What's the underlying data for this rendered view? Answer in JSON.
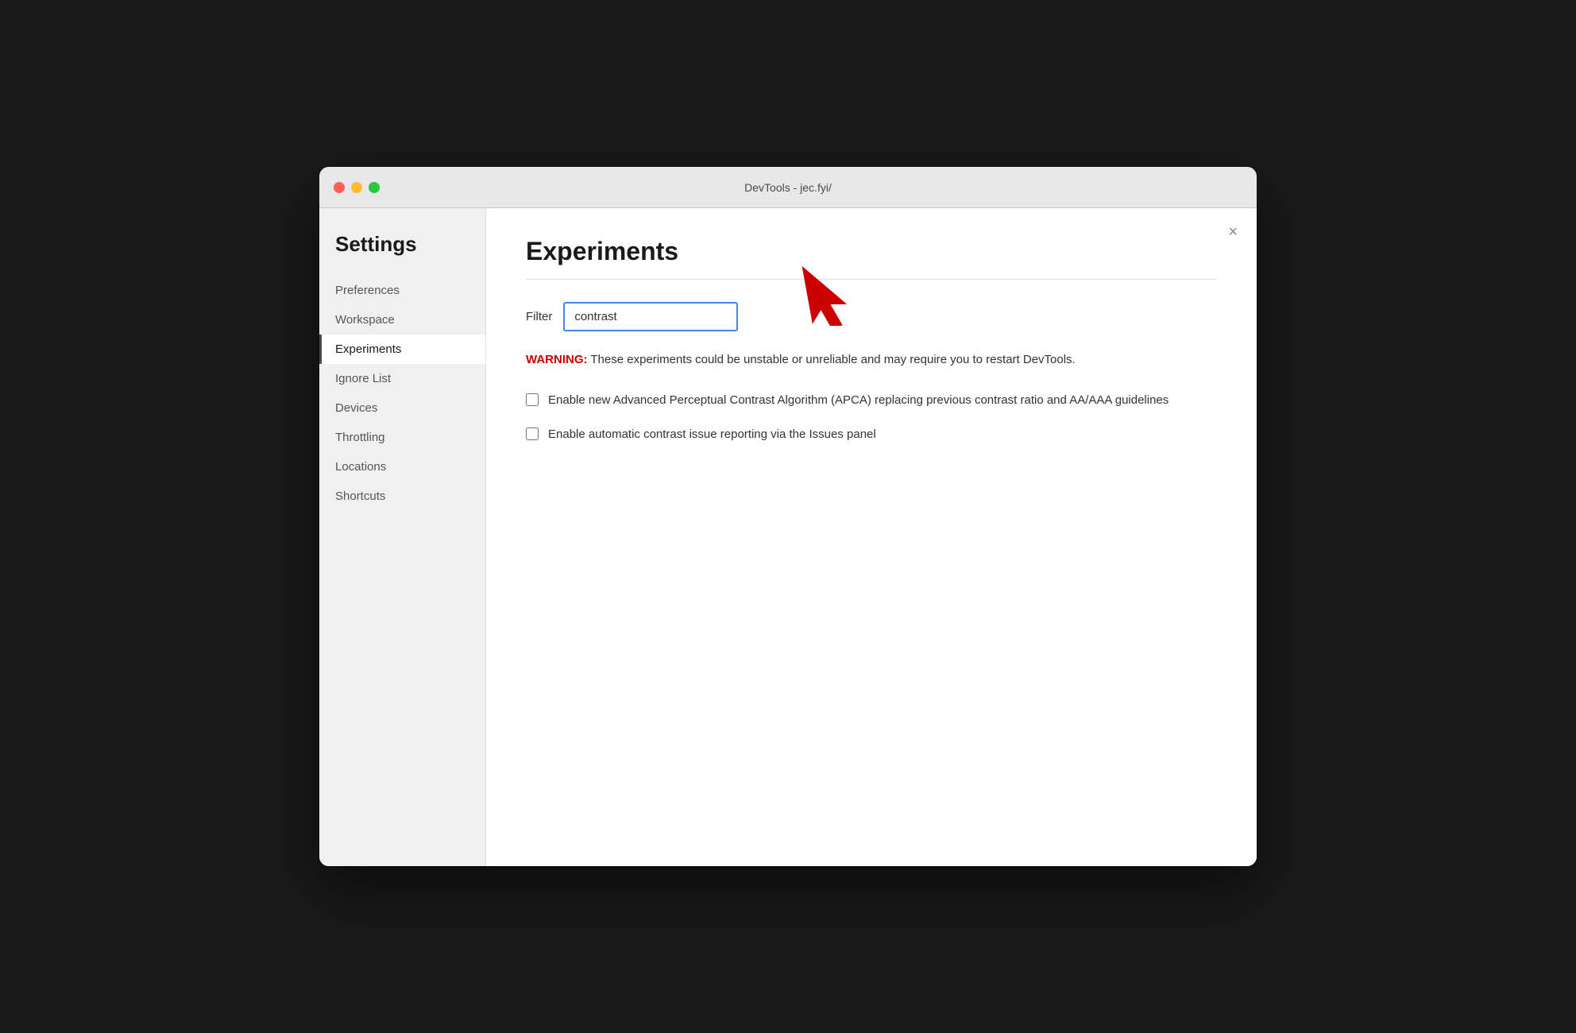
{
  "window": {
    "title": "DevTools - jec.fyi/"
  },
  "titlebar": {
    "close_label": "×"
  },
  "sidebar": {
    "heading": "Settings",
    "items": [
      {
        "id": "preferences",
        "label": "Preferences",
        "active": false
      },
      {
        "id": "workspace",
        "label": "Workspace",
        "active": false
      },
      {
        "id": "experiments",
        "label": "Experiments",
        "active": true
      },
      {
        "id": "ignore-list",
        "label": "Ignore List",
        "active": false
      },
      {
        "id": "devices",
        "label": "Devices",
        "active": false
      },
      {
        "id": "throttling",
        "label": "Throttling",
        "active": false
      },
      {
        "id": "locations",
        "label": "Locations",
        "active": false
      },
      {
        "id": "shortcuts",
        "label": "Shortcuts",
        "active": false
      }
    ]
  },
  "main": {
    "page_title": "Experiments",
    "close_label": "×",
    "filter_label": "Filter",
    "filter_value": "contrast",
    "warning_prefix": "WARNING:",
    "warning_text": " These experiments could be unstable or unreliable and may require you to restart DevTools.",
    "checkboxes": [
      {
        "id": "apca",
        "label": "Enable new Advanced Perceptual Contrast Algorithm (APCA) replacing previous contrast ratio and AA/AAA guidelines",
        "checked": false
      },
      {
        "id": "auto-contrast",
        "label": "Enable automatic contrast issue reporting via the Issues panel",
        "checked": false
      }
    ]
  }
}
